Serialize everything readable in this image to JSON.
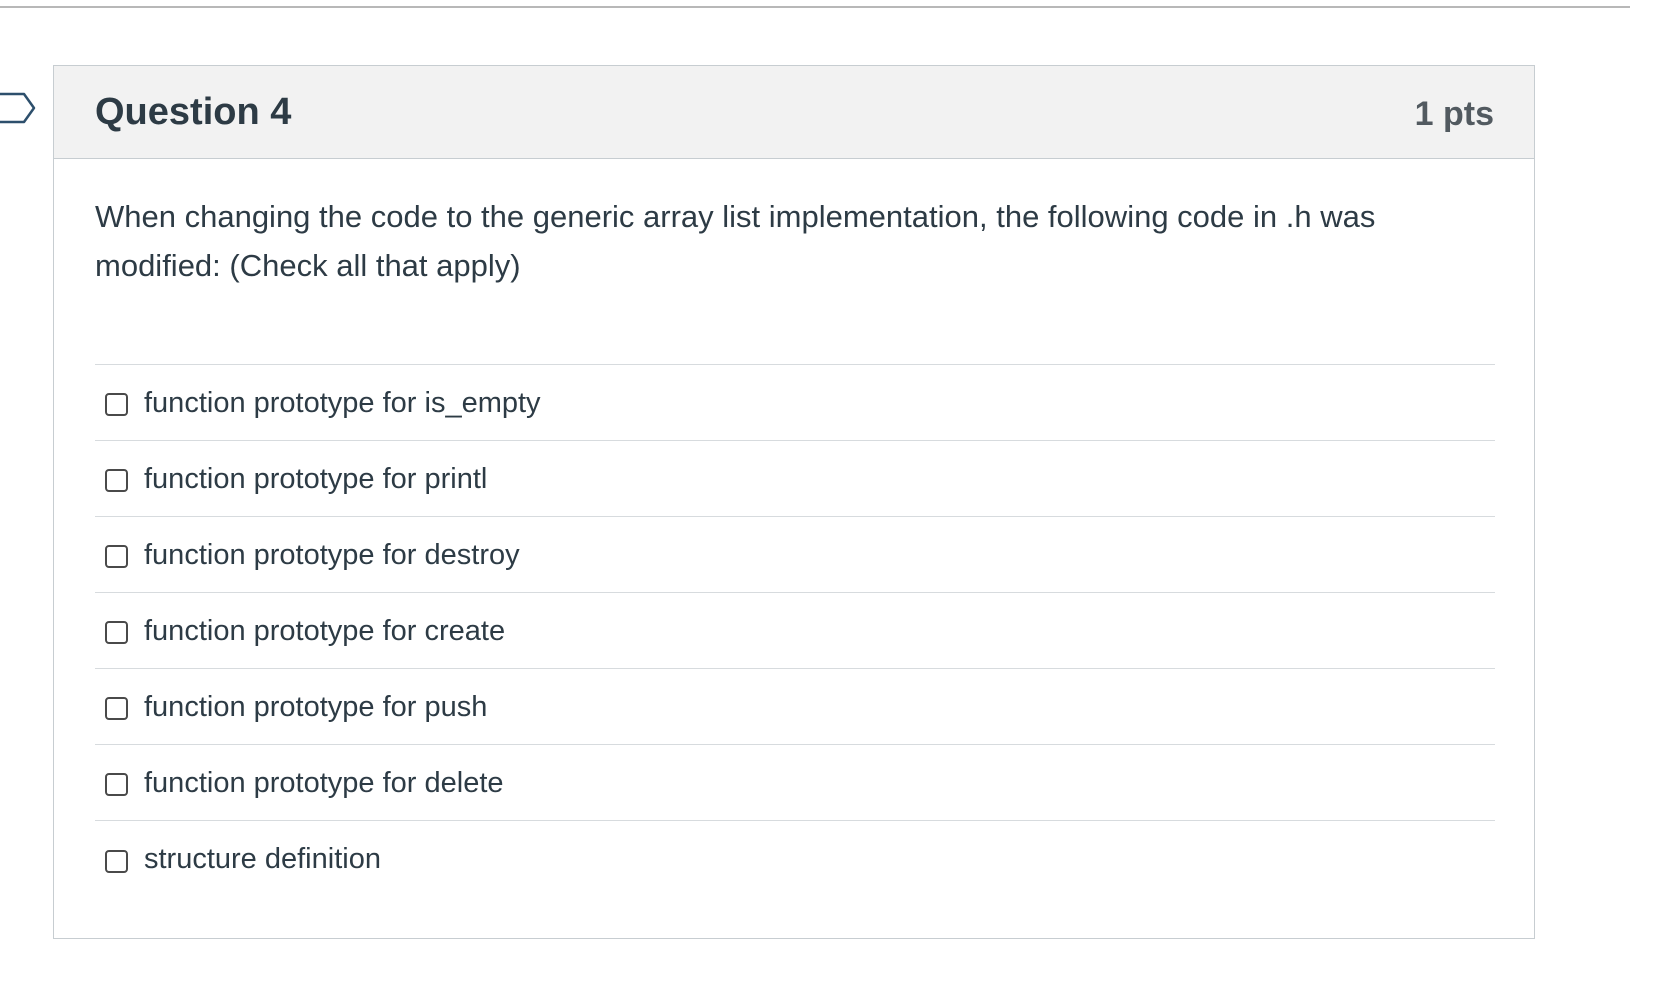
{
  "question": {
    "title": "Question 4",
    "points": "1 pts",
    "text": "When changing the code to the generic array list implementation, the following code in .h was modified: (Check all that apply)",
    "answers": [
      {
        "label": "function prototype for is_empty",
        "checked": false
      },
      {
        "label": "function prototype for printl",
        "checked": false
      },
      {
        "label": "function prototype for destroy",
        "checked": false
      },
      {
        "label": "function prototype for create",
        "checked": false
      },
      {
        "label": "function prototype for push",
        "checked": false
      },
      {
        "label": "function prototype for delete",
        "checked": false
      },
      {
        "label": "structure definition",
        "checked": false
      }
    ]
  },
  "icons": {
    "flag": "flag-question-icon"
  },
  "colors": {
    "header_bg": "#f2f2f2",
    "text": "#2d3b45",
    "border": "#c7cdd1"
  }
}
